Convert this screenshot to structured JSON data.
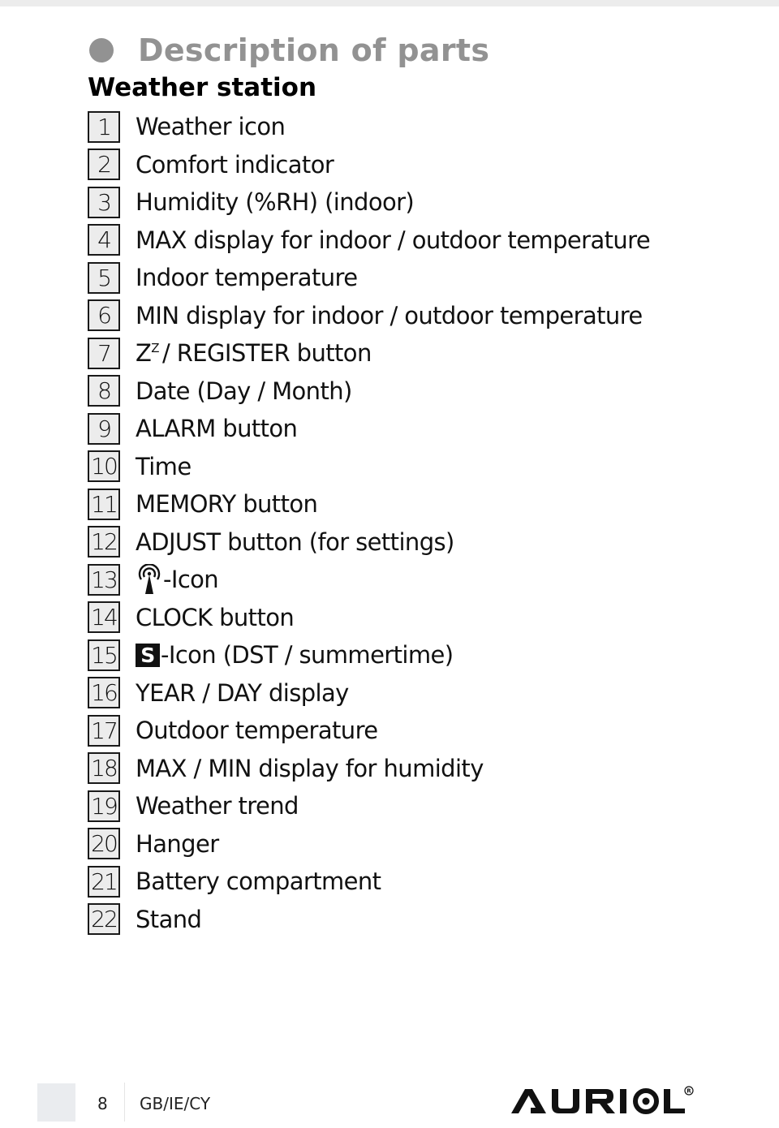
{
  "page": {
    "heading": "Description of parts",
    "subheading": "Weather station"
  },
  "parts": [
    {
      "number": "1",
      "label": "Weather icon"
    },
    {
      "number": "2",
      "label": "Comfort indicator"
    },
    {
      "number": "3",
      "label": "Humidity (%RH) (indoor)"
    },
    {
      "number": "4",
      "label": "MAX display for indoor / outdoor temperature"
    },
    {
      "number": "5",
      "label": "Indoor temperature"
    },
    {
      "number": "6",
      "label": "MIN display for indoor / outdoor temperature"
    },
    {
      "number": "7",
      "label_prefix": "Z",
      "label_sup": "Z",
      "label": "/ REGISTER button"
    },
    {
      "number": "8",
      "label": "Date (Day / Month)"
    },
    {
      "number": "9",
      "label": "ALARM button"
    },
    {
      "number": "10",
      "label": "Time"
    },
    {
      "number": "11",
      "label": "MEMORY button"
    },
    {
      "number": "12",
      "label": "ADJUST button (for settings)"
    },
    {
      "number": "13",
      "icon": "radio-signal-antenna-icon",
      "label": "-Icon"
    },
    {
      "number": "14",
      "label": "CLOCK button"
    },
    {
      "number": "15",
      "icon": "dst-s-icon",
      "icon_text": "S",
      "label": "-Icon (DST / summertime)"
    },
    {
      "number": "16",
      "label": "YEAR / DAY display"
    },
    {
      "number": "17",
      "label": "Outdoor temperature"
    },
    {
      "number": "18",
      "label": "MAX / MIN display for humidity"
    },
    {
      "number": "19",
      "label": "Weather trend"
    },
    {
      "number": "20",
      "label": "Hanger"
    },
    {
      "number": "21",
      "label": "Battery compartment"
    },
    {
      "number": "22",
      "label": "Stand"
    }
  ],
  "footer": {
    "page_number": "8",
    "region": "GB/IE/CY",
    "brand": "AURIOL",
    "registered_mark": "®"
  },
  "colors": {
    "heading_gray": "#929292",
    "box_fill": "#ececec",
    "text": "#111111"
  }
}
